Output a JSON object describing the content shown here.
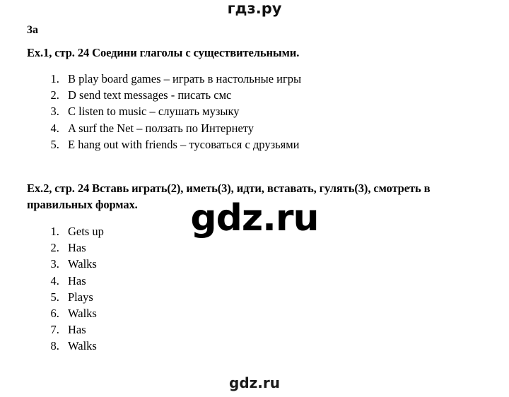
{
  "site_header": {
    "brand": "гдз.ру"
  },
  "document": {
    "section_label": "3a",
    "exercises": [
      {
        "heading": "Ex.1, стр. 24 Соедини глаголы с существительными.",
        "items": [
          "B play board games – играть в настольные игры",
          "D send text messages -  писать смс",
          "C listen to music – слушать музыку",
          "A surf the Net – ползать по Интернету",
          "E hang out with friends – тусоваться с друзьями"
        ]
      },
      {
        "heading": "Ex.2, стр. 24 Вставь играть(2), иметь(3), идти, вставать, гулять(3), смотреть в правильных формах.",
        "items": [
          "Gets up",
          "Has",
          "Walks",
          "Has",
          "Plays",
          "Walks",
          "Has",
          "Walks"
        ]
      }
    ]
  },
  "watermarks": {
    "center": "gdz.ru",
    "bottom": "gdz.ru"
  }
}
